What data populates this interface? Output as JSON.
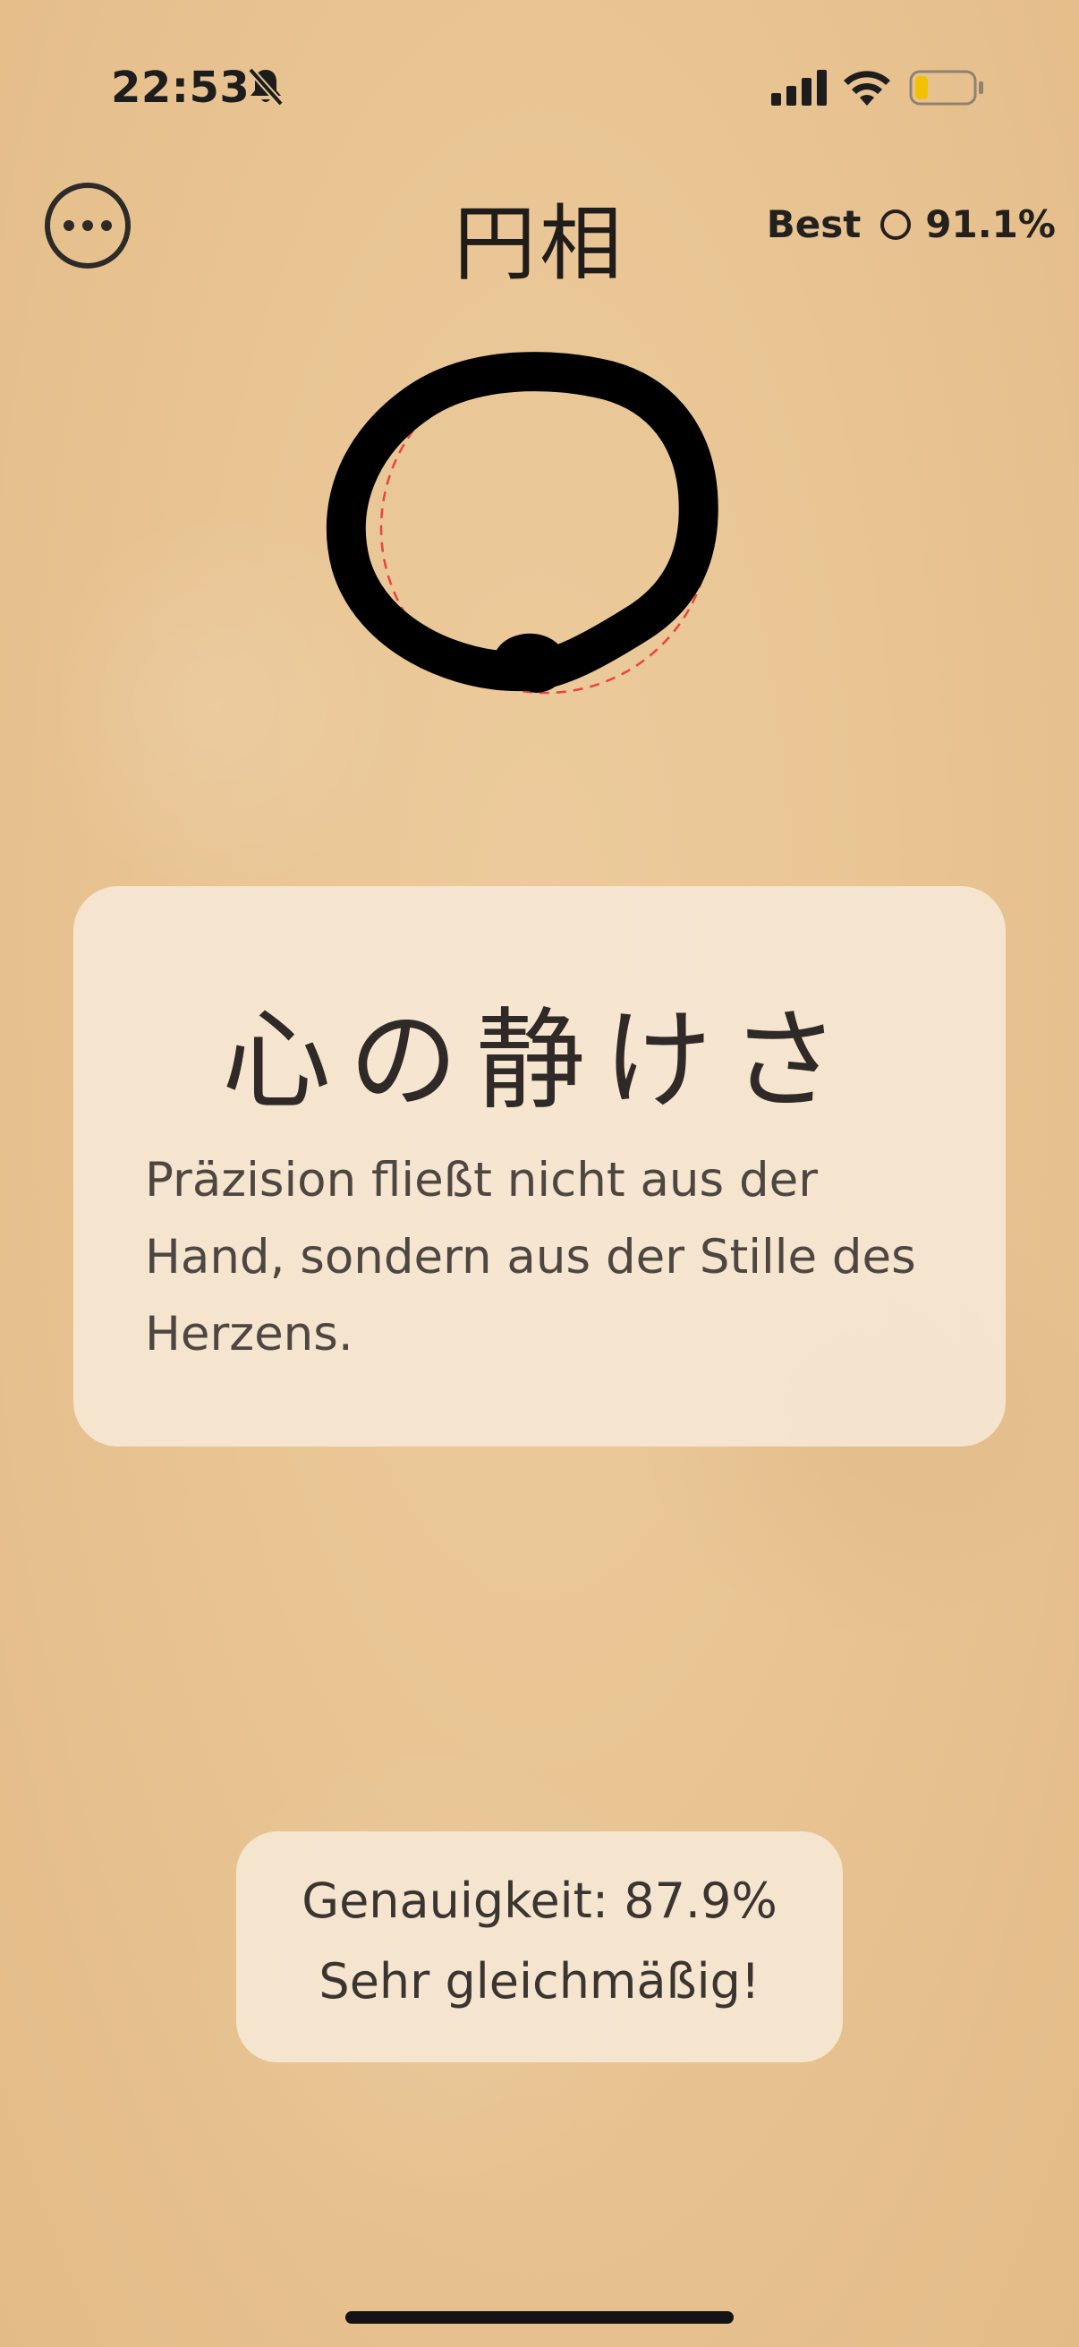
{
  "status_bar": {
    "time": "22:53",
    "icons": [
      "bell-slash-icon",
      "cellular-signal-icon",
      "wifi-icon",
      "battery-low-icon"
    ],
    "battery_color": "#f2c200"
  },
  "header": {
    "menu_icon": "ellipsis-circle-icon",
    "title": "円相",
    "best_label": "Best",
    "best_icon": "ring-icon",
    "best_value": "91.1%"
  },
  "drawing": {
    "stroke_color": "#000000",
    "guide_color": "#e8453c",
    "guide_style": "dashed"
  },
  "quote": {
    "kanji": "心の静けさ",
    "text": "Präzision fließt nicht aus der Hand, sondern aus der Stille des Herzens."
  },
  "result": {
    "accuracy": "Genauigkeit: 87.9%",
    "comment": "Sehr gleichmäßig!"
  },
  "colors": {
    "background": "#eac795",
    "card": "#f8ecdc",
    "text": "#2b2623"
  }
}
